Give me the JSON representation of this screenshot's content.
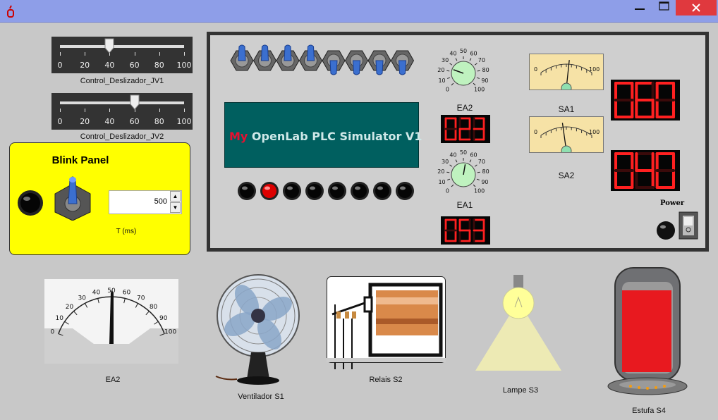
{
  "window": {
    "minimize_icon": "minimize-icon",
    "maximize_icon": "maximize-icon",
    "close_icon": "close-icon",
    "close_color": "#e0393e"
  },
  "sliders": [
    {
      "label": "Control_Deslizador_JV1",
      "value": 40,
      "ticks": [
        "0",
        "20",
        "40",
        "60",
        "80",
        "100"
      ]
    },
    {
      "label": "Control_Deslizador_JV2",
      "value": 60,
      "ticks": [
        "0",
        "20",
        "40",
        "60",
        "80",
        "100"
      ]
    }
  ],
  "blink_panel": {
    "title": "Blink Panel",
    "period_value": "500",
    "period_label": "T (ms)",
    "spin_up": "▲",
    "spin_down": "▼"
  },
  "plc": {
    "title_prefix": "My",
    "title_text": " OpenLab PLC Simulator V1",
    "inputs_count": 8,
    "outputs_leds": [
      false,
      true,
      false,
      false,
      false,
      false,
      false,
      false
    ],
    "ea2_label": "EA2",
    "ea1_label": "EA1",
    "ea2_display": "023",
    "ea1_display": "053",
    "knob_ticks": [
      "0",
      "10",
      "20",
      "30",
      "40",
      "50",
      "60",
      "70",
      "80",
      "90",
      "100"
    ],
    "sa1_label": "SA1",
    "sa2_label": "SA2",
    "sa_gauge_ticks": [
      "0",
      "100"
    ],
    "sa1_display": "060",
    "sa2_display": "040",
    "power_label": "Power",
    "power_switch": "on"
  },
  "bottom": {
    "ea2_meter_label": "EA2",
    "ea2_meter_ticks": [
      "0",
      "10",
      "20",
      "30",
      "40",
      "50",
      "60",
      "70",
      "80",
      "90",
      "100"
    ],
    "fan_label": "Ventilador S1",
    "relay_label": "Relais  S2",
    "lamp_label": "Lampe S3",
    "heater_label": "Estufa S4"
  },
  "colors": {
    "background": "#c8c8c8",
    "title_bar": "#8e9ee8",
    "blink_panel": "#ffff00",
    "plc_display": "#005f5f",
    "led_segment_on": "#ff2020",
    "led_segment_off": "#3a0a0a",
    "gauge_face": "#f6e2a6",
    "heater_red": "#e8191f"
  }
}
